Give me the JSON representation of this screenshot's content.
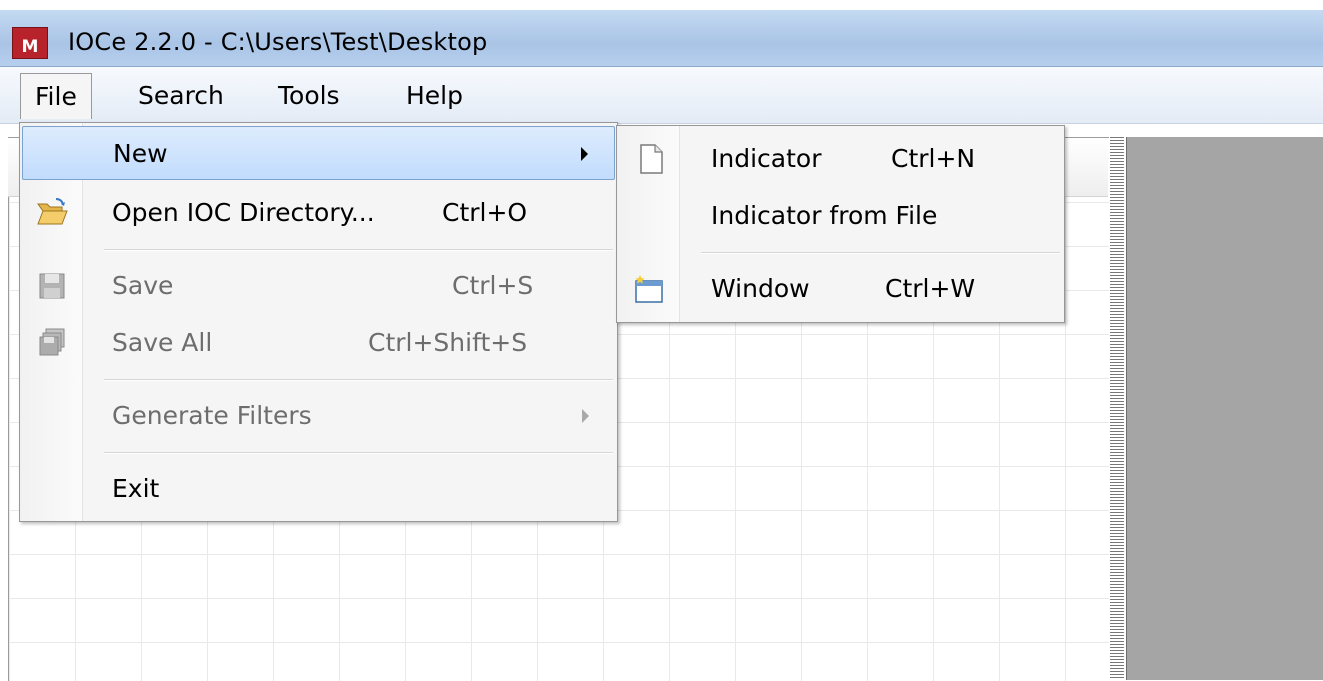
{
  "window": {
    "title": "IOCe 2.2.0 - C:\\Users\\Test\\Desktop",
    "icon_letter": "M"
  },
  "menubar": {
    "items": [
      "File",
      "Search",
      "Tools",
      "Help"
    ]
  },
  "file_menu": {
    "items": [
      {
        "label": "New",
        "shortcut": "",
        "enabled": true,
        "submenu": true,
        "highlighted": true
      },
      {
        "label": "Open IOC Directory...",
        "shortcut": "Ctrl+O",
        "enabled": true,
        "icon": "folder-open-icon"
      },
      {
        "label": "Save",
        "shortcut": "Ctrl+S",
        "enabled": false,
        "icon": "save-icon"
      },
      {
        "label": "Save All",
        "shortcut": "Ctrl+Shift+S",
        "enabled": false,
        "icon": "save-all-icon"
      },
      {
        "label": "Generate Filters",
        "shortcut": "",
        "enabled": false,
        "submenu": true
      },
      {
        "label": "Exit",
        "shortcut": "",
        "enabled": true
      }
    ]
  },
  "new_submenu": {
    "items": [
      {
        "label": "Indicator",
        "shortcut": "Ctrl+N",
        "icon": "new-document-icon"
      },
      {
        "label": "Indicator from File",
        "shortcut": ""
      },
      {
        "label": "Window",
        "shortcut": "Ctrl+W",
        "icon": "new-window-icon"
      }
    ]
  },
  "colors": {
    "highlight": "#c2dcfd",
    "menu_bg": "#f5f5f5",
    "pane_gray": "#a5a5a5",
    "icon_red": "#b8232b"
  }
}
